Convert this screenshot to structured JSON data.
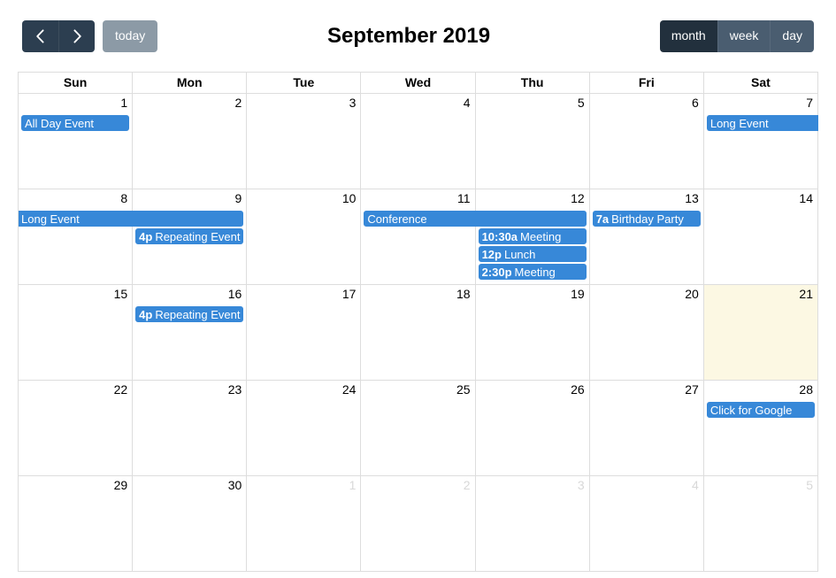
{
  "toolbar": {
    "prev_label": "prev",
    "next_label": "next",
    "today_label": "today",
    "title": "September 2019",
    "views": [
      {
        "key": "month",
        "label": "month",
        "active": true
      },
      {
        "key": "week",
        "label": "week",
        "active": false
      },
      {
        "key": "day",
        "label": "day",
        "active": false
      }
    ]
  },
  "colors": {
    "event": "#3788d8",
    "toolbar_dark": "#2C3E50",
    "view_button": "#4a5d70",
    "view_button_active": "#22303d",
    "today_button": "#8c9aa6",
    "today_cell": "#fcf8e3",
    "grid_border": "#dddddd",
    "other_month_text": "#d8d8d8"
  },
  "grid": {
    "day_headers": [
      "Sun",
      "Mon",
      "Tue",
      "Wed",
      "Thu",
      "Fri",
      "Sat"
    ],
    "weeks": [
      {
        "days": [
          {
            "num": "1",
            "other": false,
            "today": false
          },
          {
            "num": "2",
            "other": false,
            "today": false
          },
          {
            "num": "3",
            "other": false,
            "today": false
          },
          {
            "num": "4",
            "other": false,
            "today": false
          },
          {
            "num": "5",
            "other": false,
            "today": false
          },
          {
            "num": "6",
            "other": false,
            "today": false
          },
          {
            "num": "7",
            "other": false,
            "today": false
          }
        ],
        "rows": [
          [
            {
              "start": 0,
              "span": 1,
              "time": "",
              "title": "All Day Event",
              "bleed_right": false
            },
            {
              "start": 6,
              "span": 1,
              "time": "",
              "title": "Long Event",
              "bleed_right": true
            }
          ]
        ]
      },
      {
        "days": [
          {
            "num": "8",
            "other": false,
            "today": false
          },
          {
            "num": "9",
            "other": false,
            "today": false
          },
          {
            "num": "10",
            "other": false,
            "today": false
          },
          {
            "num": "11",
            "other": false,
            "today": false
          },
          {
            "num": "12",
            "other": false,
            "today": false
          },
          {
            "num": "13",
            "other": false,
            "today": false
          },
          {
            "num": "14",
            "other": false,
            "today": false
          }
        ],
        "rows": [
          [
            {
              "start": 0,
              "span": 2,
              "time": "",
              "title": "Long Event",
              "bleed_left": true
            },
            {
              "start": 3,
              "span": 2,
              "time": "",
              "title": "Conference"
            },
            {
              "start": 5,
              "span": 1,
              "time": "7a",
              "title": "Birthday Party"
            }
          ],
          [
            {
              "start": 1,
              "span": 1,
              "time": "4p",
              "title": "Repeating Event"
            },
            {
              "start": 4,
              "span": 1,
              "time": "10:30a",
              "title": "Meeting"
            }
          ],
          [
            {
              "start": 4,
              "span": 1,
              "time": "12p",
              "title": "Lunch"
            }
          ],
          [
            {
              "start": 4,
              "span": 1,
              "time": "2:30p",
              "title": "Meeting"
            }
          ]
        ]
      },
      {
        "days": [
          {
            "num": "15",
            "other": false,
            "today": false
          },
          {
            "num": "16",
            "other": false,
            "today": false
          },
          {
            "num": "17",
            "other": false,
            "today": false
          },
          {
            "num": "18",
            "other": false,
            "today": false
          },
          {
            "num": "19",
            "other": false,
            "today": false
          },
          {
            "num": "20",
            "other": false,
            "today": false
          },
          {
            "num": "21",
            "other": false,
            "today": true
          }
        ],
        "rows": [
          [
            {
              "start": 1,
              "span": 1,
              "time": "4p",
              "title": "Repeating Event"
            }
          ]
        ]
      },
      {
        "days": [
          {
            "num": "22",
            "other": false,
            "today": false
          },
          {
            "num": "23",
            "other": false,
            "today": false
          },
          {
            "num": "24",
            "other": false,
            "today": false
          },
          {
            "num": "25",
            "other": false,
            "today": false
          },
          {
            "num": "26",
            "other": false,
            "today": false
          },
          {
            "num": "27",
            "other": false,
            "today": false
          },
          {
            "num": "28",
            "other": false,
            "today": false
          }
        ],
        "rows": [
          [
            {
              "start": 6,
              "span": 1,
              "time": "",
              "title": "Click for Google"
            }
          ]
        ]
      },
      {
        "days": [
          {
            "num": "29",
            "other": false,
            "today": false
          },
          {
            "num": "30",
            "other": false,
            "today": false
          },
          {
            "num": "1",
            "other": true,
            "today": false
          },
          {
            "num": "2",
            "other": true,
            "today": false
          },
          {
            "num": "3",
            "other": true,
            "today": false
          },
          {
            "num": "4",
            "other": true,
            "today": false
          },
          {
            "num": "5",
            "other": true,
            "today": false
          }
        ],
        "rows": []
      }
    ]
  }
}
